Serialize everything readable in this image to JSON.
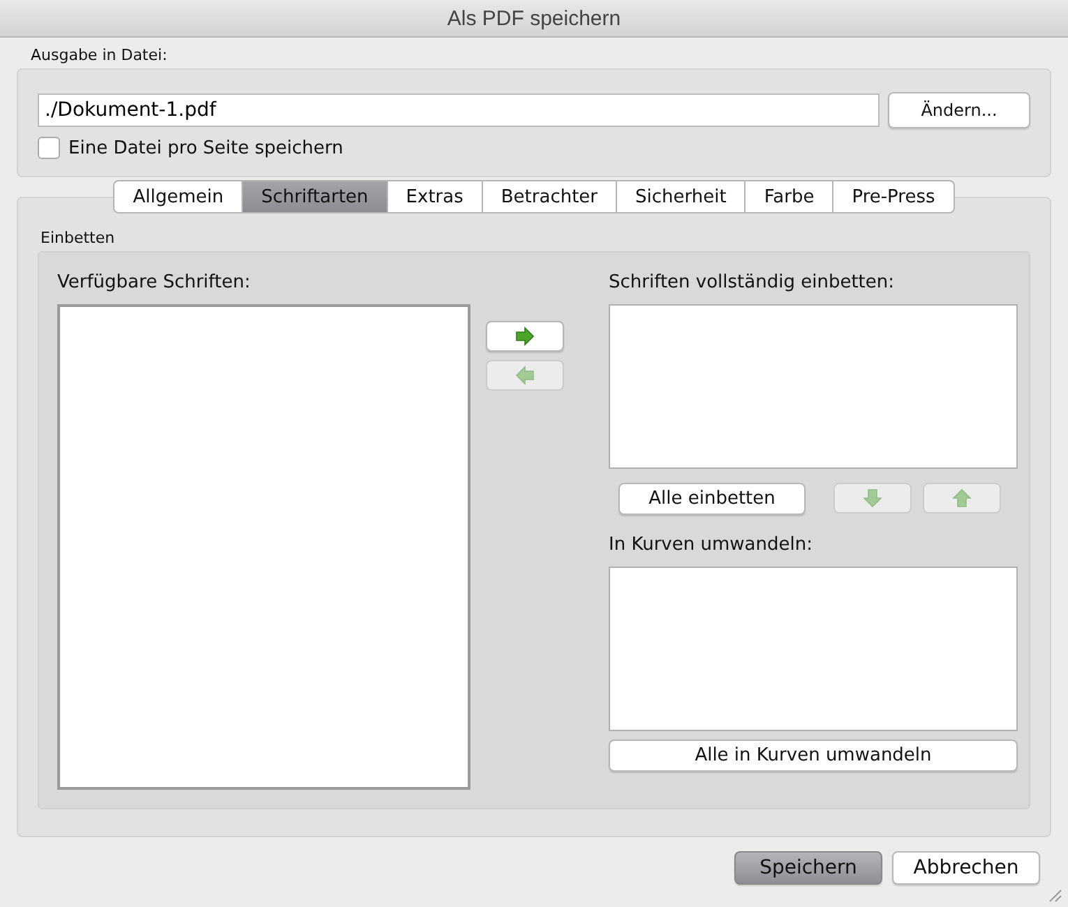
{
  "window": {
    "title": "Als PDF speichern"
  },
  "output": {
    "label": "Ausgabe in Datei:",
    "value": "./Dokument-1.pdf",
    "change_button": "Ändern...",
    "per_page": {
      "label": "Eine Datei pro Seite speichern",
      "checked": false
    }
  },
  "tabs": [
    {
      "label": "Allgemein",
      "selected": false
    },
    {
      "label": "Schriftarten",
      "selected": true
    },
    {
      "label": "Extras",
      "selected": false
    },
    {
      "label": "Betrachter",
      "selected": false
    },
    {
      "label": "Sicherheit",
      "selected": false
    },
    {
      "label": "Farbe",
      "selected": false
    },
    {
      "label": "Pre-Press",
      "selected": false
    }
  ],
  "embed": {
    "group_label": "Einbetten",
    "available_label": "Verfügbare Schriften:",
    "move_buttons": [
      {
        "kind": "right",
        "disabled": false
      },
      {
        "kind": "left",
        "disabled": true
      }
    ],
    "full_label": "Schriften vollständig einbetten:",
    "embed_all": "Alle einbetten",
    "order_buttons": [
      {
        "kind": "down",
        "disabled": true
      },
      {
        "kind": "up",
        "disabled": true
      }
    ],
    "outline_label": "In Kurven umwandeln:",
    "outline_all": "Alle in Kurven umwandeln"
  },
  "buttons": [
    {
      "label": "Speichern",
      "default": true
    },
    {
      "label": "Abbrechen",
      "default": false
    }
  ]
}
